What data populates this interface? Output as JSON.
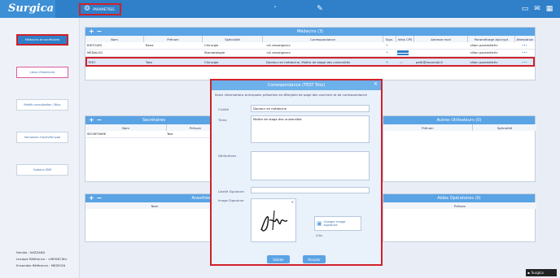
{
  "app": {
    "logo": "Surgica"
  },
  "topbar": {
    "parametrage_label": "PARAMETRES"
  },
  "sidebar": {
    "items": [
      {
        "label": "Médecins et secrétaires"
      },
      {
        "label": "Lieux d'exercices"
      },
      {
        "label": "Motifs consultation / Bloc"
      },
      {
        "label": "Semaines d'activité type"
      },
      {
        "label": "Options SMS"
      }
    ],
    "footer": {
      "line1": "Famille : WIZZARD",
      "line2": "Lexique Référence : <MEDECIN>",
      "line3": "Ensemble Référence : MEDECIN"
    }
  },
  "medecins": {
    "title": "Médecins (3)",
    "columns": [
      "Nom",
      "Prénom",
      "Spécialité",
      "Correspondance",
      "Sign.",
      "Infos CPS",
      "Adresse mail",
      "Paramétrage Apicrypt",
      "Attestation"
    ],
    "rows": [
      {
        "nom": "BISTOURI",
        "prenom": "Rene",
        "specialite": "Chirurgie",
        "corr": "<A renseigner>",
        "mail": "",
        "apicrypt": "<Non paramétré>",
        "att": "•••"
      },
      {
        "nom": "MEDALOG",
        "prenom": "",
        "specialite": "Stomatologie",
        "corr": "<A renseigner>",
        "mail": "",
        "apicrypt": "<Non paramétré>",
        "att": "•••"
      },
      {
        "nom": "TEST",
        "prenom": "Toto",
        "specialite": "Chirurgie",
        "corr": "Docteur en médecine, Maître de stage des universités",
        "mail": "petit@monmail.fr",
        "apicrypt": "<Non paramétré>",
        "att": "•••"
      }
    ]
  },
  "secretaires": {
    "title": "Secrétaires",
    "columns": [
      "Nom",
      "Prénom"
    ],
    "rows": [
      {
        "nom": "SECRETAIRE",
        "prenom": "Test"
      }
    ]
  },
  "autres": {
    "title": "Autres Utilisateurs (0)",
    "columns": [
      "Prénom",
      "Spécialité"
    ]
  },
  "anesthesistes": {
    "title": "Anesthésis",
    "columns": [
      "Nom"
    ]
  },
  "aides": {
    "title": "Aides Opératoires (0)",
    "columns": [
      "Prénom"
    ]
  },
  "modal": {
    "title": "Correspondance (TEST Toto)",
    "intro": "Saisir informations principales présentes en-tête/pied de page des courriers et de correspondance",
    "civilite_label": "Civilité",
    "civilite_value": "Docteur en médecine",
    "titres_label": "Titres",
    "titres_value": "Maître de stage des universités",
    "attributions_label": "Attributions",
    "libelle_label": "Libellé Signature",
    "image_label": "Image Signature",
    "upload_label": "Charger image signature",
    "size_label": "4 Ko",
    "validate_label": "Valider",
    "cancel_label": "Annuler"
  },
  "badge": {
    "label": "Surgica"
  }
}
